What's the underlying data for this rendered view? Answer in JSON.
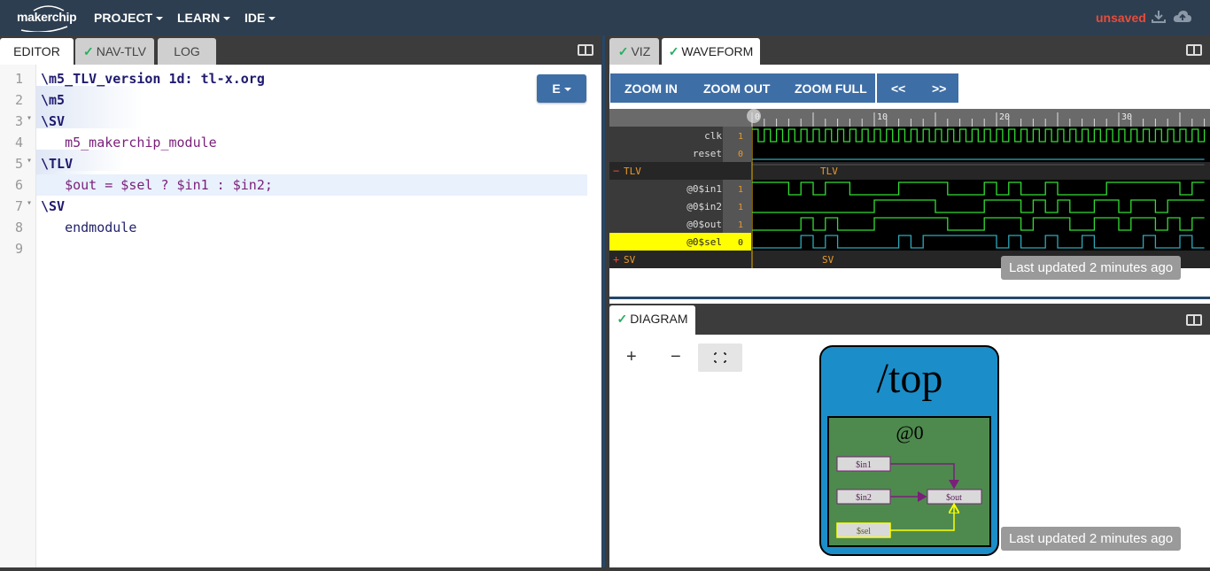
{
  "topbar": {
    "logo": "makerchip",
    "menus": [
      "PROJECT",
      "LEARN",
      "IDE"
    ],
    "status": "unsaved",
    "icons": [
      "download-icon",
      "cloud-upload-icon"
    ]
  },
  "editor": {
    "tabs": [
      {
        "label": "EDITOR",
        "active": true,
        "check": false
      },
      {
        "label": "NAV-TLV",
        "active": false,
        "check": true
      },
      {
        "label": "LOG",
        "active": false,
        "check": false
      }
    ],
    "mode_button": "E",
    "lines": [
      {
        "num": "1",
        "fold": "",
        "text": "\\m5_TLV_version 1d: tl-x.org"
      },
      {
        "num": "2",
        "fold": "",
        "text": "\\m5"
      },
      {
        "num": "3",
        "fold": "▾",
        "text": "\\SV"
      },
      {
        "num": "4",
        "fold": "",
        "text": "   m5_makerchip_module"
      },
      {
        "num": "5",
        "fold": "▾",
        "text": "\\TLV"
      },
      {
        "num": "6",
        "fold": "",
        "text": "   $out = $sel ? $in1 : $in2;"
      },
      {
        "num": "7",
        "fold": "▾",
        "text": "\\SV"
      },
      {
        "num": "8",
        "fold": "",
        "text": "   endmodule"
      },
      {
        "num": "9",
        "fold": "",
        "text": ""
      }
    ]
  },
  "waveform": {
    "tabs": [
      {
        "label": "VIZ",
        "active": false,
        "check": true
      },
      {
        "label": "WAVEFORM",
        "active": true,
        "check": true
      }
    ],
    "buttons": [
      "ZOOM IN",
      "ZOOM OUT",
      "ZOOM FULL",
      "<<",
      ">>"
    ],
    "ruler": [
      "0",
      "10",
      "20",
      "30"
    ],
    "signals": [
      {
        "name": "clk",
        "value": "1"
      },
      {
        "name": "reset",
        "value": "0"
      },
      {
        "name": "TLV",
        "value": "",
        "group": true,
        "prefix": "−"
      },
      {
        "name": "@0$in1",
        "value": "1"
      },
      {
        "name": "@0$in2",
        "value": "1"
      },
      {
        "name": "@0$out",
        "value": "1"
      },
      {
        "name": "@0$sel",
        "value": "0",
        "selected": true
      },
      {
        "name": "SV",
        "value": "",
        "group": true,
        "prefix": "+"
      }
    ],
    "group_labels": {
      "tlv": "TLV",
      "sv": "SV"
    },
    "last_updated": "Last updated 2 minutes ago"
  },
  "diagram": {
    "tab": "DIAGRAM",
    "controls": [
      "+",
      "−"
    ],
    "scope": "/top",
    "stage": "@0",
    "nodes": [
      "$in1",
      "$in2",
      "$sel",
      "$out"
    ],
    "last_updated": "Last updated 2 minutes ago"
  },
  "colors": {
    "accent": "#3e6ea6",
    "topbar": "#2d3e50",
    "unsaved": "#e74c3c",
    "wave": "#33dd33",
    "diagram_outer": "#1b8ec9",
    "diagram_inner": "#4e8a4e"
  }
}
